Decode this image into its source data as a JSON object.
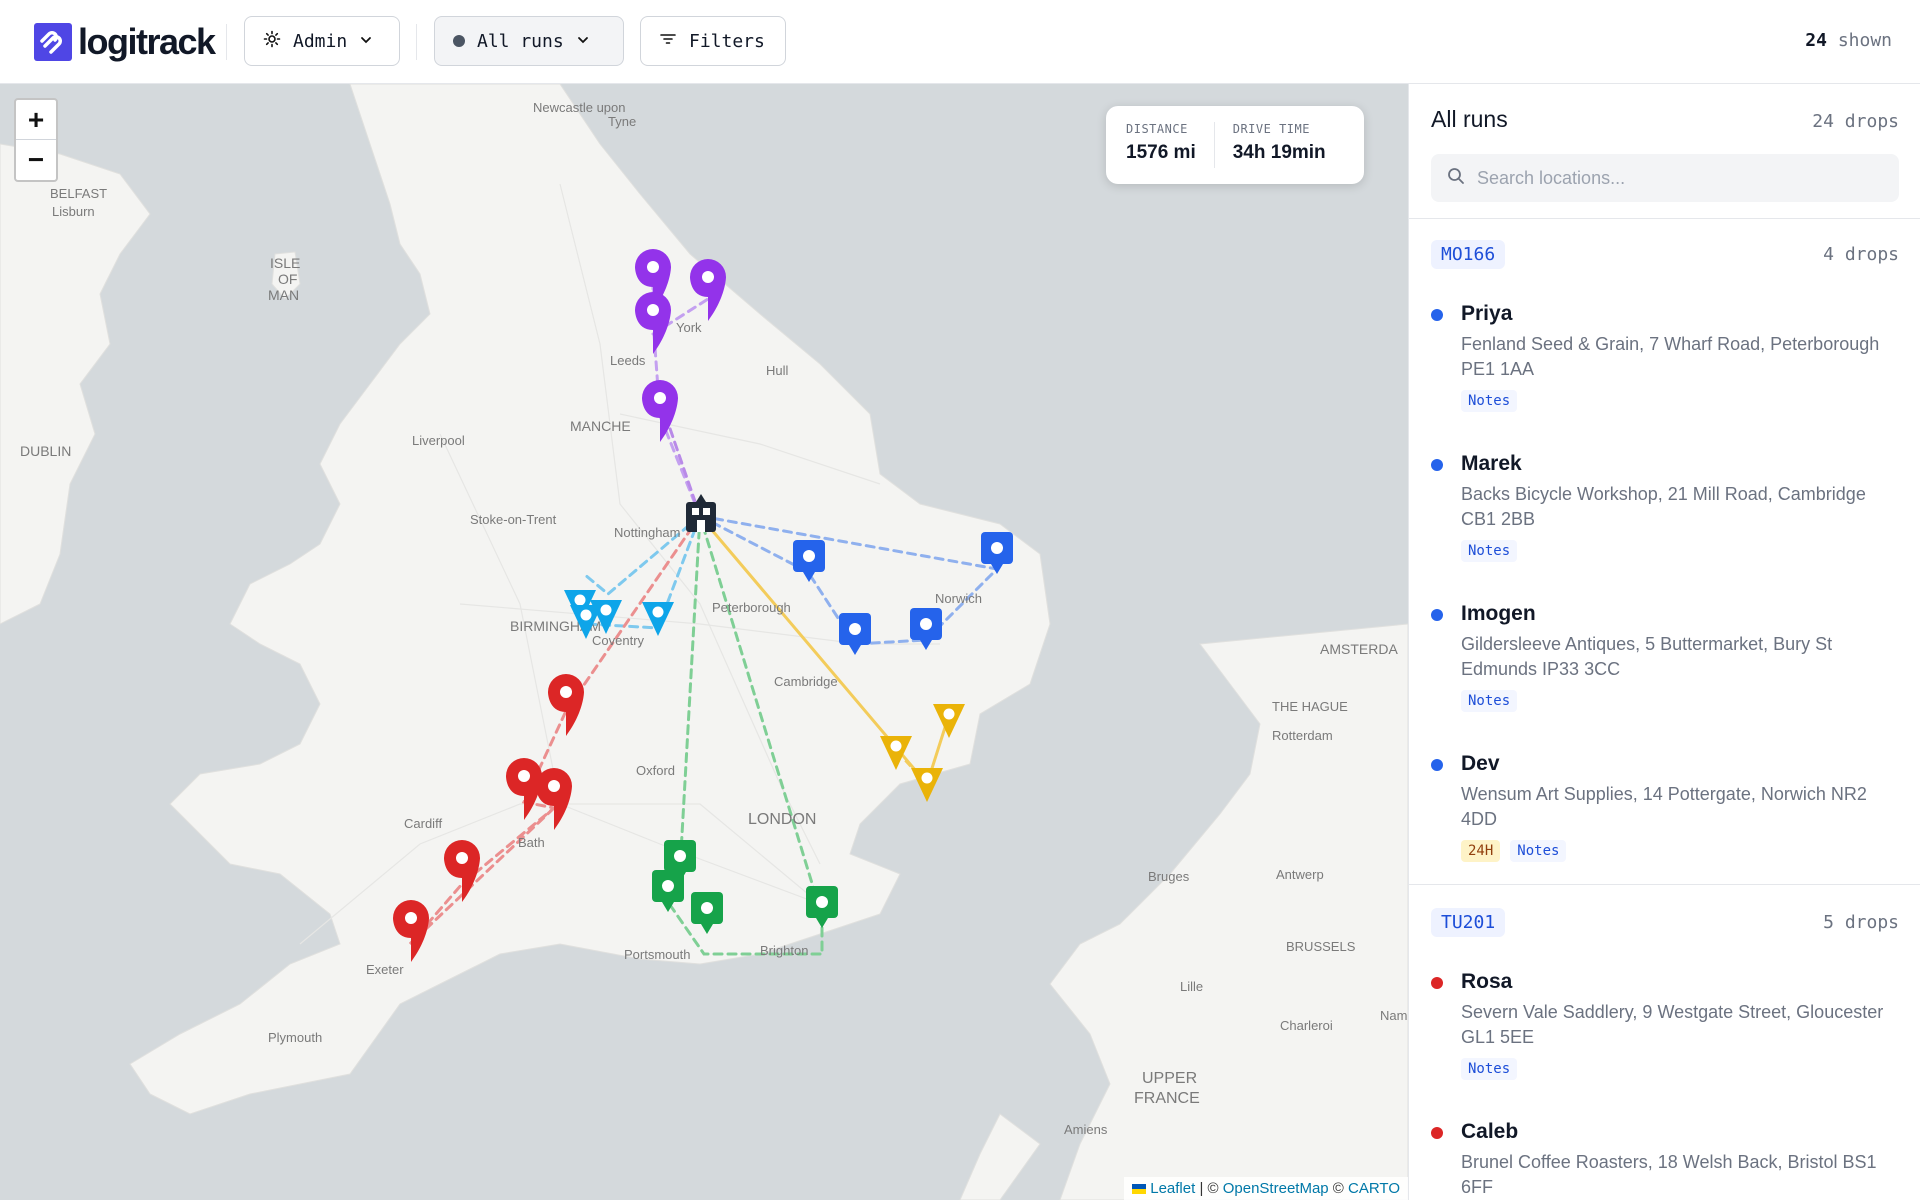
{
  "app": {
    "name": "logitrack"
  },
  "toolbar": {
    "role_label": "Admin",
    "runs_label": "All runs",
    "filters_label": "Filters",
    "shown_count": "24",
    "shown_suffix": "shown"
  },
  "map": {
    "zoom_in": "+",
    "zoom_out": "−",
    "stats": {
      "distance_label": "DISTANCE",
      "distance_value": "1576 mi",
      "drive_label": "DRIVE TIME",
      "drive_value": "34h 19min"
    },
    "attribution": {
      "leaflet": "Leaflet",
      "sep1": " | © ",
      "osm": "OpenStreetMap",
      "sep2": " © ",
      "carto": "CARTO"
    },
    "place_labels": {
      "newcastle": "Newcastle upon",
      "tyne": "Tyne",
      "belfast": "BELFAST",
      "lisburn": "Lisburn",
      "isle": "ISLE",
      "of": "OF",
      "man": "MAN",
      "york": "York",
      "leeds": "Leeds",
      "hull": "Hull",
      "manchester": "MANCHE",
      "liverpool": "Liverpool",
      "dublin": "DUBLIN",
      "stoke": "Stoke-on-Trent",
      "nottingham": "Nottingham",
      "peterborough": "Peterborough",
      "norwich": "Norwich",
      "birmingham": "BIRMINGHAM",
      "coventry": "Coventry",
      "cambridge": "Cambridge",
      "amsterdam": "AMSTERDA",
      "hague": "THE HAGUE",
      "rotterdam": "Rotterdam",
      "oxford": "Oxford",
      "cardiff": "Cardiff",
      "bath": "Bath",
      "london": "LONDON",
      "bruges": "Bruges",
      "antwerp": "Antwerp",
      "portsmouth": "Portsmouth",
      "brighton": "Brighton",
      "exeter": "Exeter",
      "brussels": "BRUSSELS",
      "lille": "Lille",
      "charleroi": "Charleroi",
      "nam": "Nam",
      "plymouth": "Plymouth",
      "upper": "UPPER",
      "france": "FRANCE",
      "amiens": "Amiens"
    },
    "colors": {
      "water": "#d4d9dc",
      "land": "#f4f4f2",
      "purple": "#9333ea",
      "blue": "#2563eb",
      "cyan": "#0ea5e9",
      "red": "#dc2626",
      "green": "#16a34a",
      "yellow": "#eab308",
      "depot": "#1f2937"
    }
  },
  "sidebar": {
    "title": "All runs",
    "count": "24 drops",
    "search_placeholder": "Search locations...",
    "groups": [
      {
        "code": "MO166",
        "count": "4 drops",
        "color": "#2563eb",
        "stops": [
          {
            "name": "Priya",
            "address": "Fenland Seed & Grain, 7 Wharf Road, Peterborough PE1 1AA",
            "tags": [
              "Notes"
            ]
          },
          {
            "name": "Marek",
            "address": "Backs Bicycle Workshop, 21 Mill Road, Cambridge CB1 2BB",
            "tags": [
              "Notes"
            ]
          },
          {
            "name": "Imogen",
            "address": "Gildersleeve Antiques, 5 Buttermarket, Bury St Edmunds IP33 3CC",
            "tags": [
              "Notes"
            ]
          },
          {
            "name": "Dev",
            "address": "Wensum Art Supplies, 14 Pottergate, Norwich NR2 4DD",
            "tags": [
              "24H",
              "Notes"
            ]
          }
        ]
      },
      {
        "code": "TU201",
        "count": "5 drops",
        "color": "#dc2626",
        "stops": [
          {
            "name": "Rosa",
            "address": "Severn Vale Saddlery, 9 Westgate Street, Gloucester GL1 5EE",
            "tags": [
              "Notes"
            ]
          },
          {
            "name": "Caleb",
            "address": "Brunel Coffee Roasters, 18 Welsh Back, Bristol BS1 6FF",
            "tags": []
          }
        ]
      }
    ]
  }
}
